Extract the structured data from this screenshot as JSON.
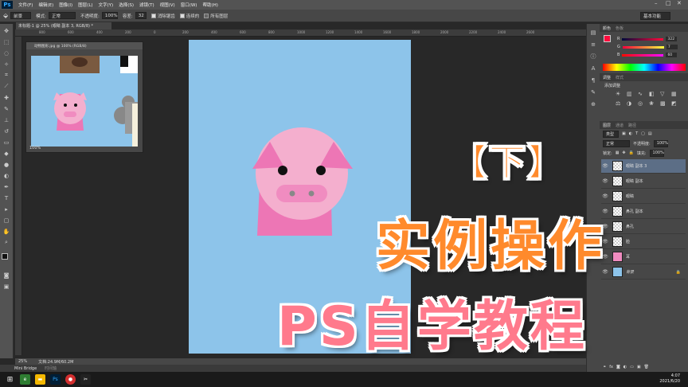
{
  "app": {
    "logo": "Ps"
  },
  "menu": [
    "文件(F)",
    "编辑(E)",
    "图像(I)",
    "图层(L)",
    "文字(Y)",
    "选择(S)",
    "滤镜(T)",
    "视图(V)",
    "窗口(W)",
    "帮助(H)"
  ],
  "options": {
    "tool_preset": "前景",
    "mode_label": "模式:",
    "mode_value": "正常",
    "opacity_label": "不透明度:",
    "opacity_value": "100%",
    "tolerance_label": "容差:",
    "tolerance_value": "32",
    "antialias_label": "消除锯齿",
    "contiguous_label": "连续的",
    "all_layers_label": "所有图层"
  },
  "workspace": "基本功能",
  "document": {
    "tab_title": "未标题-1 @ 25% (眼睛 副本 3, RGB/8) *",
    "zoom": "25%",
    "doc_size": "文档:24.9M/60.2M"
  },
  "ruler_ticks": [
    "800",
    "600",
    "400",
    "200",
    "0",
    "200",
    "400",
    "600",
    "800",
    "1000",
    "1200",
    "1400",
    "1600",
    "1800",
    "2000",
    "2200",
    "2400",
    "2600"
  ],
  "navigator": {
    "title": "动物图形.jpg @ 100% (RGB/8)",
    "zoom": "100%"
  },
  "status": {
    "minibridge": "Mini Bridge",
    "timeline": "时间轴"
  },
  "color_panel": {
    "tabs": [
      "颜色",
      "色板"
    ],
    "r_label": "R",
    "r_value": "322",
    "g_label": "G",
    "g_value": "7",
    "b_label": "B",
    "b_value": "60"
  },
  "adjust_panel": {
    "tabs": [
      "调整",
      "样式"
    ],
    "title": "添加调整"
  },
  "layers_panel": {
    "tabs": [
      "图层",
      "通道",
      "路径"
    ],
    "kind_label": "类型",
    "blend_mode": "正常",
    "opacity_label": "不透明度:",
    "opacity_value": "100%",
    "lock_label": "锁定:",
    "fill_label": "填充:",
    "fill_value": "100%",
    "layers": [
      {
        "name": "眼睛 副本 3",
        "selected": true
      },
      {
        "name": "眼睛 副本",
        "selected": false
      },
      {
        "name": "眼睛",
        "selected": false
      },
      {
        "name": "鼻孔 副本",
        "selected": false
      },
      {
        "name": "鼻孔",
        "selected": false
      },
      {
        "name": "脸",
        "selected": false
      },
      {
        "name": "耳",
        "selected": false
      },
      {
        "name": "背景",
        "selected": false
      }
    ]
  },
  "taskbar": {
    "time": "4:07",
    "date": "2021/6/20"
  },
  "overlay": {
    "line1": "【下】",
    "line2": "实例操作",
    "line3": "PS自学教程"
  },
  "colors": {
    "canvas_bg": "#8dc4ea",
    "pig_face": "#f4afce",
    "pig_body": "#ed76b5",
    "pig_snout": "#f08cc0",
    "accent_orange": "#ff8a2c",
    "accent_pink": "#ff7a8c"
  }
}
